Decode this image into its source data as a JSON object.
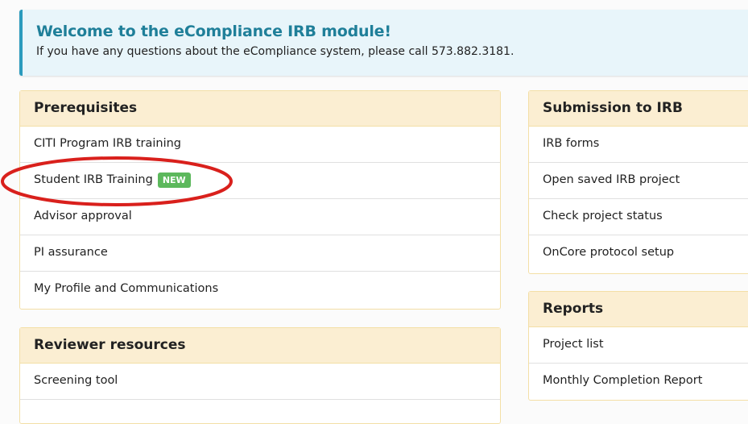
{
  "welcome": {
    "title": "Welcome to the eCompliance IRB module!",
    "message": "If you have any questions about the eCompliance system, please call 573.882.3181.",
    "accent_color": "#2a9bbd",
    "background_color": "#e8f5fa"
  },
  "panels": {
    "prerequisites": {
      "title": "Prerequisites",
      "items": [
        {
          "label": "CITI Program IRB training"
        },
        {
          "label": "Student IRB Training",
          "badge": "NEW"
        },
        {
          "label": "Advisor approval"
        },
        {
          "label": "PI assurance"
        },
        {
          "label": "My Profile and Communications"
        }
      ]
    },
    "reviewer_resources": {
      "title": "Reviewer resources",
      "items": [
        {
          "label": "Screening tool"
        }
      ]
    },
    "submission": {
      "title": "Submission to IRB",
      "items": [
        {
          "label": "IRB forms"
        },
        {
          "label": "Open saved IRB project"
        },
        {
          "label": "Check project status"
        },
        {
          "label": "OnCore protocol setup"
        }
      ]
    },
    "reports": {
      "title": "Reports",
      "items": [
        {
          "label": "Project list"
        },
        {
          "label": "Monthly Completion Report"
        }
      ]
    }
  },
  "colors": {
    "panel_header_bg": "#fbeed2",
    "panel_border": "#f3dfa6",
    "badge_bg": "#5cb85c",
    "annotation_red": "#d9201c"
  }
}
